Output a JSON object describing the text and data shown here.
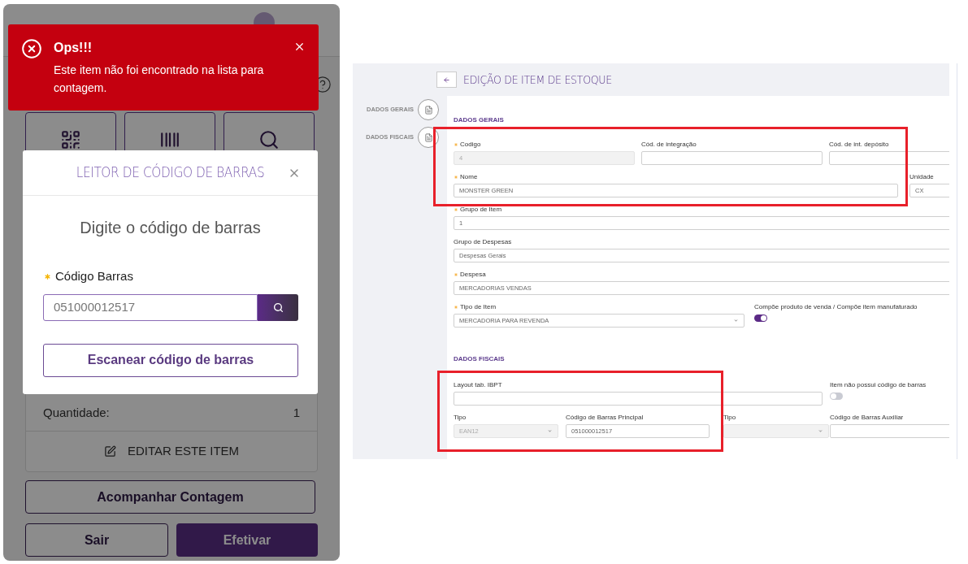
{
  "mobile": {
    "toast": {
      "title": "Ops!!!",
      "message": "Este item não foi encontrado na lista para contagem."
    },
    "modal": {
      "title": "LEITOR DE CÓDIGO DE BARRAS",
      "heading": "Digite o código de barras",
      "field": {
        "label": "Código Barras",
        "required": true,
        "value": "051000012517"
      },
      "scan_button": "Escanear código de barras"
    },
    "quantity": {
      "label": "Quantidade:",
      "value": "1"
    },
    "edit_action": "EDITAR ESTE ITEM",
    "follow_button": "Acompanhar Contagem",
    "buttons": [
      {
        "label": "Sair",
        "kind": "outline"
      },
      {
        "label": "Efetivar",
        "kind": "primary"
      }
    ]
  },
  "web": {
    "title": "EDIÇÃO DE ITEM DE ESTOQUE",
    "steps": [
      {
        "label": "DADOS GERAIS"
      },
      {
        "label": "DADOS FISCAIS"
      }
    ],
    "sections": [
      {
        "title": "DADOS GERAIS",
        "rows": [
          [
            {
              "kind": "text",
              "label": "Codigo",
              "required": true,
              "value": "4",
              "disabled": true
            },
            {
              "kind": "text",
              "label": "Cód. de integração",
              "required": false,
              "disabled": false
            },
            {
              "kind": "text",
              "label": "Cód. de int. depósito",
              "required": false,
              "disabled": false
            }
          ],
          [
            {
              "kind": "text",
              "label": "Nome",
              "required": true,
              "value": "MONSTER GREEN",
              "disabled": false
            },
            {
              "kind": "text",
              "label": "Unidade",
              "required": false,
              "value": "CX",
              "disabled": false
            }
          ],
          [
            {
              "kind": "text",
              "label": "Grupo de Item",
              "required": true,
              "value": "1",
              "disabled": false
            }
          ],
          [
            {
              "kind": "text",
              "label": "Grupo de Despesas",
              "required": false,
              "value": "Despesas Gerais",
              "disabled": false
            }
          ],
          [
            {
              "kind": "text",
              "label": "Despesa",
              "required": true,
              "value": "MERCADORIAS VENDAS",
              "disabled": false
            }
          ],
          [
            {
              "kind": "select",
              "label": "Tipo de Item",
              "required": true,
              "value": "MERCADORIA PARA REVENDA",
              "disabled": false
            },
            {
              "kind": "toggle",
              "label": "Compõe produto de venda / Compõe item manufaturado",
              "on": true
            }
          ]
        ]
      },
      {
        "title": "DADOS FISCAIS",
        "rows": [
          [
            {
              "kind": "text",
              "label": "Layout tab. IBPT",
              "required": false,
              "disabled": false
            },
            "",
            "",
            {
              "kind": "toggle",
              "label": "Item não possui código de barras",
              "on": false
            }
          ],
          [
            {
              "kind": "select",
              "label": "Tipo",
              "required": false,
              "value": "EAN12",
              "disabled": true
            },
            {
              "kind": "text",
              "label": "Código de Barras Principal",
              "required": false,
              "value": "051000012517",
              "disabled": false
            },
            {
              "kind": "select",
              "label": "Tipo",
              "required": false,
              "disabled": true
            },
            {
              "kind": "text",
              "label": "Código de Barras Auxiliar",
              "required": false,
              "disabled": false
            }
          ]
        ]
      }
    ]
  }
}
